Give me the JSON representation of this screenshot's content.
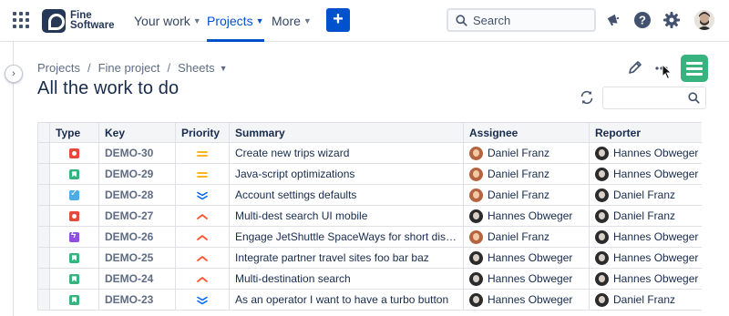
{
  "nav": {
    "brand_line1": "Fine",
    "brand_line2": "Software",
    "items": [
      {
        "label": "Your work"
      },
      {
        "label": "Projects"
      },
      {
        "label": "More"
      }
    ],
    "create_label": "+",
    "search_placeholder": "Search"
  },
  "breadcrumb": {
    "items": [
      "Projects",
      "Fine project",
      "Sheets"
    ]
  },
  "page": {
    "title": "All the work to do"
  },
  "table": {
    "columns": [
      "Type",
      "Key",
      "Priority",
      "Summary",
      "Assignee",
      "Reporter"
    ],
    "rows": [
      {
        "type": "bug",
        "key": "DEMO-30",
        "priority": "medium",
        "summary": "Create new trips wizard",
        "assignee": "Daniel Franz",
        "assignee_avatar": "df",
        "reporter": "Hannes Obweger",
        "reporter_avatar": "ho"
      },
      {
        "type": "story",
        "key": "DEMO-29",
        "priority": "medium",
        "summary": "Java-script optimizations",
        "assignee": "Daniel Franz",
        "assignee_avatar": "df",
        "reporter": "Hannes Obweger",
        "reporter_avatar": "ho"
      },
      {
        "type": "task",
        "key": "DEMO-28",
        "priority": "lowest",
        "summary": "Account settings defaults",
        "assignee": "Daniel Franz",
        "assignee_avatar": "df",
        "reporter": "Daniel Franz",
        "reporter_avatar": "ho"
      },
      {
        "type": "bug",
        "key": "DEMO-27",
        "priority": "high",
        "summary": "Multi-dest search UI mobile",
        "assignee": "Hannes Obweger",
        "assignee_avatar": "ho",
        "reporter": "Daniel Franz",
        "reporter_avatar": "ho"
      },
      {
        "type": "epic",
        "key": "DEMO-26",
        "priority": "high",
        "summary": "Engage JetShuttle SpaceWays for short distan...",
        "assignee": "Daniel Franz",
        "assignee_avatar": "df",
        "reporter": "Hannes Obweger",
        "reporter_avatar": "ho"
      },
      {
        "type": "story",
        "key": "DEMO-25",
        "priority": "high",
        "summary": "Integrate partner travel sites foo bar baz",
        "assignee": "Hannes Obweger",
        "assignee_avatar": "ho",
        "reporter": "Hannes Obweger",
        "reporter_avatar": "ho"
      },
      {
        "type": "story",
        "key": "DEMO-24",
        "priority": "high",
        "summary": "Multi-destination search",
        "assignee": "Hannes Obweger",
        "assignee_avatar": "ho",
        "reporter": "Hannes Obweger",
        "reporter_avatar": "ho"
      },
      {
        "type": "story",
        "key": "DEMO-23",
        "priority": "lowest",
        "summary": "As an operator I want to have a turbo button",
        "assignee": "Hannes Obweger",
        "assignee_avatar": "ho",
        "reporter": "Daniel Franz",
        "reporter_avatar": "ho"
      }
    ]
  },
  "colors": {
    "accent": "#0052cc",
    "bug": "#e5493a",
    "story": "#36b37e",
    "task": "#4bade8",
    "epic": "#904ee2",
    "priority_medium": "#ffab00",
    "priority_high": "#ff5630",
    "priority_lowest": "#0065ff"
  },
  "icons": {
    "app_switcher": "grid-icon",
    "notifications": "megaphone-icon",
    "help": "help-icon",
    "settings": "gear-icon",
    "edit": "pencil-icon",
    "more": "more-icon",
    "refresh": "refresh-icon",
    "sheet_search": "search-icon",
    "app_logo": "fine-sheets-logo-icon"
  }
}
